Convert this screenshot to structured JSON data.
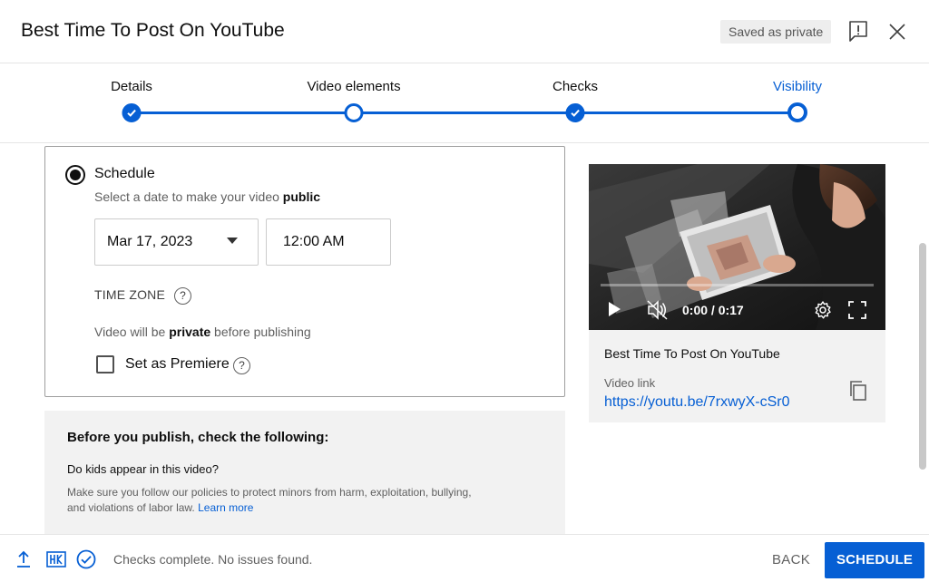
{
  "header": {
    "title": "Best Time To Post On YouTube",
    "saved_badge": "Saved as private",
    "icons": [
      "feedback-icon",
      "close-icon"
    ]
  },
  "stepper": {
    "steps": [
      {
        "label": "Details",
        "state": "complete"
      },
      {
        "label": "Video elements",
        "state": "visited"
      },
      {
        "label": "Checks",
        "state": "complete"
      },
      {
        "label": "Visibility",
        "state": "current"
      }
    ],
    "accent": "#065fd4"
  },
  "schedule": {
    "label": "Schedule",
    "hint_prefix": "Select a date to make your video ",
    "hint_bold": "public",
    "date_value": "Mar 17, 2023",
    "time_value": "12:00 AM",
    "timezone_label": "TIME ZONE",
    "help_glyph": "?",
    "private_prefix": "Video will be ",
    "private_bold": "private",
    "private_suffix": " before publishing",
    "premiere_label": "Set as Premiere",
    "premiere_checked": false
  },
  "publish_check": {
    "title": "Before you publish, check the following:",
    "question": "Do kids appear in this video?",
    "body": "Make sure you follow our policies to protect minors from harm, exploitation, bullying, and violations of labor law. ",
    "learn_more": "Learn more"
  },
  "preview": {
    "time_readout": "0:00 / 0:17",
    "progress": 0,
    "title": "Best Time To Post On YouTube",
    "link_label": "Video link",
    "link": "https://youtu.be/7rxwyX-cSr0"
  },
  "footer": {
    "status": "Checks complete. No issues found.",
    "hd_label": "HD",
    "back_label": "BACK",
    "schedule_label": "SCHEDULE"
  }
}
